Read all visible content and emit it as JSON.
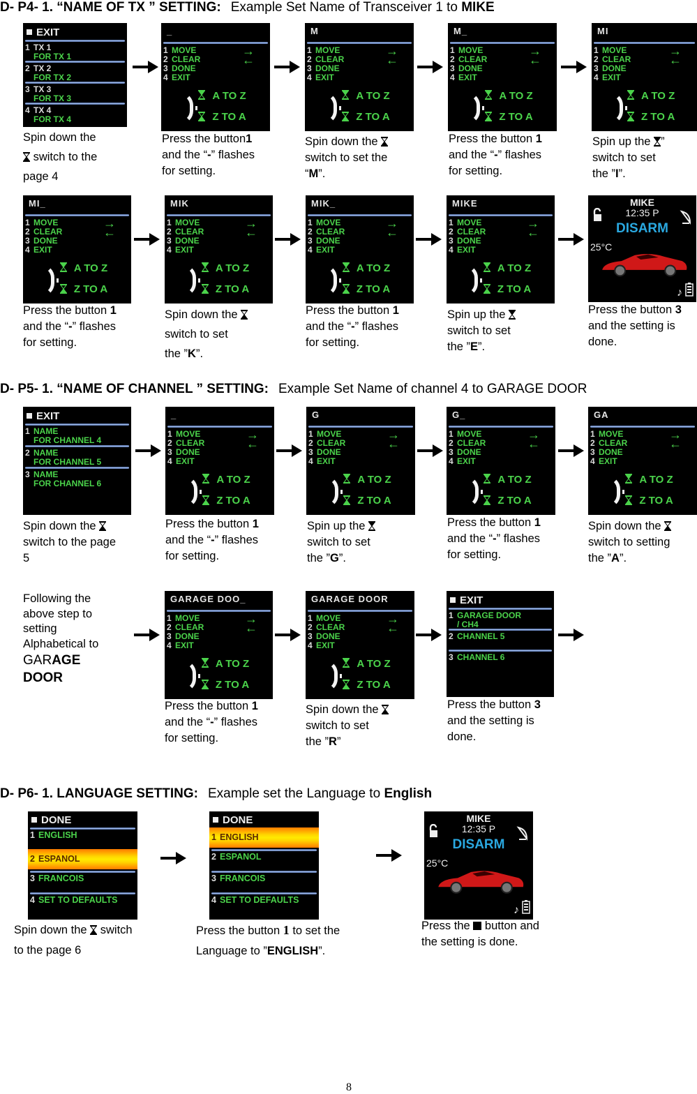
{
  "sections": [
    {
      "heading": "D- P4- 1. “NAME OF TX ” SETTING:",
      "example_prefix": "Example Set Name of Transceiver 1 to",
      "example_target": "MIKE"
    },
    {
      "heading": "D- P5- 1. “NAME OF CHANNEL ” SETTING:",
      "example": "Example Set Name of channel 4 to GARAGE DOOR"
    },
    {
      "heading": "D- P6- 1. LANGUAGE SETTING:",
      "example_prefix": "Example set the Language to",
      "example_target": "English"
    }
  ],
  "edit_menu": {
    "items": [
      {
        "num": "1",
        "label": "MOVE",
        "arrow": "→"
      },
      {
        "num": "2",
        "label": "CLEAR",
        "arrow": "←"
      },
      {
        "num": "3",
        "label": "DONE"
      },
      {
        "num": "4",
        "label": "EXIT"
      }
    ],
    "up_label": "A TO Z",
    "down_label": "Z TO A"
  },
  "tx_list": {
    "header": "EXIT",
    "items": [
      {
        "num": "1",
        "name": "TX 1",
        "sub": "FOR TX 1"
      },
      {
        "num": "2",
        "name": "TX 2",
        "sub": "FOR TX 2"
      },
      {
        "num": "3",
        "name": "TX 3",
        "sub": "FOR TX 3"
      },
      {
        "num": "4",
        "name": "TX 4",
        "sub": "FOR TX 4"
      }
    ]
  },
  "channel_list": {
    "header": "EXIT",
    "items": [
      {
        "num": "1",
        "name": "NAME",
        "sub": "FOR CHANNEL 4"
      },
      {
        "num": "2",
        "name": "NAME",
        "sub": "FOR CHANNEL 5"
      },
      {
        "num": "3",
        "name": "NAME",
        "sub": "FOR CHANNEL 6"
      }
    ]
  },
  "channel_done": {
    "header": "EXIT",
    "items": [
      {
        "num": "1",
        "name": "GARAGE DOOR",
        "sub": "/ CH4"
      },
      {
        "num": "2",
        "name": "CHANNEL 5"
      },
      {
        "num": "3",
        "name": "CHANNEL 6"
      }
    ]
  },
  "home_screen": {
    "name": "MIKE",
    "time": "12:35 P",
    "status": "DISARM",
    "temperature": "25°C",
    "status_color": "#2aa8e0"
  },
  "language_menu": {
    "header": "DONE",
    "items": [
      {
        "num": "1",
        "label": "ENGLISH"
      },
      {
        "num": "2",
        "label": "ESPANOL"
      },
      {
        "num": "3",
        "label": "FRANCOIS"
      },
      {
        "num": "4",
        "label": "SET TO DEFAULTS"
      }
    ]
  },
  "p4": {
    "row1": [
      {
        "title": "",
        "caption": [
          "Spin down the",
          " switch to the",
          "page 4"
        ]
      },
      {
        "title": "_",
        "caption_html": "Press the button<b>1</b><br>and the “<b>-</b>” flashes<br>for setting."
      },
      {
        "title": "M",
        "caption_html": "Spin down the ⧗<br>switch to set the<br>“<b>M</b>”."
      },
      {
        "title": "M_",
        "caption_html": "Press the button <b>1</b><br>and the “<b>-</b>” flashes<br>for setting."
      },
      {
        "title": "MI",
        "caption_html": "Spin up the ⧗”<br>switch to set<br>the ”<b>I</b>”."
      }
    ],
    "row2": [
      {
        "title": "MI_",
        "caption_html": "Press the button <b>1</b><br>and the “<b>-</b>” flashes<br>for setting."
      },
      {
        "title": "MIK",
        "caption_html": "Spin down the ⧗<br>switch to set<br>the ”<b>K</b>”."
      },
      {
        "title": "MIK_",
        "caption_html": "Press the button <b>1</b><br>and the “<b>-</b>” flashes<br>for setting."
      },
      {
        "title": "MIKE",
        "caption_html": "Spin up the ⧗<br>switch to set<br>the ”<b>E</b>”."
      },
      {
        "caption_html": "Press the button <b>3</b><br>and the setting is<br>done."
      }
    ]
  },
  "captions": {
    "p4_1": [
      "Spin down the",
      "switch to the",
      "page 4"
    ],
    "p4_2": {
      "a": "Press the button",
      "b": "1",
      "c": "and the “",
      "d": "-",
      "e": "” flashes",
      "f": "for setting."
    },
    "p4_3": {
      "a": "Spin down the",
      "b": "switch to set the",
      "c": "“",
      "d": "M",
      "e": "”."
    },
    "p4_4": {
      "a": "Press the button ",
      "b": "1",
      "c": "and the “",
      "d": "-",
      "e": "” flashes",
      "f": "for setting."
    },
    "p4_5": {
      "a": "Spin up the",
      "a2": "”",
      "b": "switch to set",
      "c": "the ”",
      "d": "I",
      "e": "”."
    },
    "p4_6": {
      "a": "Press the button ",
      "b": "1",
      "c": "and the “",
      "d": "-",
      "e": "” flashes",
      "f": "for setting."
    },
    "p4_7": {
      "a": "Spin down the",
      "b": "switch to set",
      "c": "the ”",
      "d": "K",
      "e": "”."
    },
    "p4_8": {
      "a": "Press the button ",
      "b": "1",
      "c": "and the “",
      "d": "-",
      "e": "” flashes",
      "f": "for setting."
    },
    "p4_9": {
      "a": "Spin up the",
      "b": "switch to set",
      "c": "the ”",
      "d": "E",
      "e": "”."
    },
    "p4_10": {
      "a": "Press the button ",
      "b": "3",
      "c": "and the setting is",
      "d": "done."
    },
    "p5_1": {
      "a": "Spin down the",
      "b": "switch to the page",
      "c": "5"
    },
    "p5_2": {
      "a": "Press the button ",
      "b": "1",
      "c": "and the “",
      "d": "-",
      "e": "” flashes",
      "f": "for setting."
    },
    "p5_3": {
      "a": "Spin up the",
      "b": "switch to set",
      "c": "the ”",
      "d": "G",
      "e": "”."
    },
    "p5_4": {
      "a": "Press the button ",
      "b": "1",
      "c": "and the “",
      "d": "-",
      "e": "” flashes",
      "f": "for setting."
    },
    "p5_5": {
      "a": "Spin down the",
      "b": "switch to setting",
      "c": "the ”",
      "d": "A",
      "e": "”."
    },
    "p5_6": {
      "a": "Following the",
      "b": "above step to",
      "c": "setting",
      "d": "Alphabetical to",
      "e": "GAR",
      "f": "AGE",
      "g": "DOOR"
    },
    "p5_7": {
      "a": "Press the button ",
      "b": "1",
      "c": "and the “",
      "d": "-",
      "e": "” flashes",
      "f": "for setting."
    },
    "p5_8": {
      "a": "Spin down the",
      "b": "switch to set",
      "c": "the ”",
      "d": "R",
      "e": "”"
    },
    "p5_9": {
      "a": "Press the button ",
      "b": "3",
      "c": "and the setting is",
      "d": "done."
    },
    "p6_1": {
      "a": "Spin down the",
      "b": "switch",
      "c": "to the page 6"
    },
    "p6_2": {
      "a": "Press the button ",
      "b": "1",
      "c": " to set the",
      "d": "Language to ”",
      "e": "ENGLISH",
      "f": "”."
    },
    "p6_3": {
      "a": "Press the",
      "b": "button and",
      "c": "the setting is done."
    }
  },
  "screen_titles": {
    "p4": [
      "_",
      "M",
      "M_",
      "MI",
      "MI_",
      "MIK",
      "MIK_",
      "MIKE"
    ],
    "p5": [
      "_",
      "G",
      "G_",
      "GA",
      "GARAGE DOO_",
      "GARAGE DOOR"
    ]
  },
  "page_number": "8",
  "colors": {
    "menu_green": "#4bd34b",
    "highlight_orange": "#ffb000",
    "divider_blue": "#a9c1ec"
  }
}
